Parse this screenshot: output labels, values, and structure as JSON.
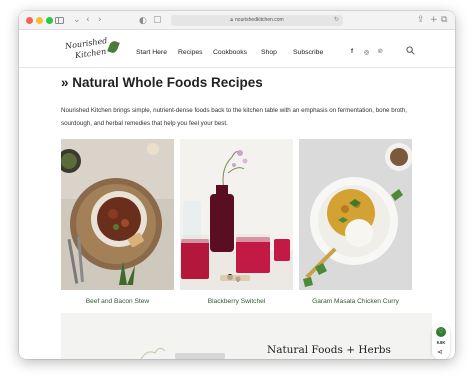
{
  "browser": {
    "url": "nourishedkitchen.com"
  },
  "site": {
    "logo_line1": "Nourished",
    "logo_line2": "Kitchen"
  },
  "nav": {
    "items": [
      "Start Here",
      "Recipes",
      "Cookbooks",
      "Shop",
      "Subscribe"
    ]
  },
  "social": {
    "facebook": "f",
    "instagram": "◎",
    "pinterest": "℗"
  },
  "page": {
    "title": "» Natural Whole Foods Recipes",
    "intro": "Nourished Kitchen brings simple, nutrient-dense foods back to the kitchen table with an emphasis on fermentation, bone broth, sourdough, and herbal remedies that help you feel your best."
  },
  "recipes": [
    {
      "title": "Beef and Bacon Stew"
    },
    {
      "title": "Blackberry Switchel"
    },
    {
      "title": "Garam Masala Chicken Curry"
    }
  ],
  "promo": {
    "heading": "Natural Foods + Herbs"
  },
  "share": {
    "count": "9.8K"
  },
  "colors": {
    "brand_green": "#2f5a2f",
    "accent_green": "#2e7d32"
  }
}
